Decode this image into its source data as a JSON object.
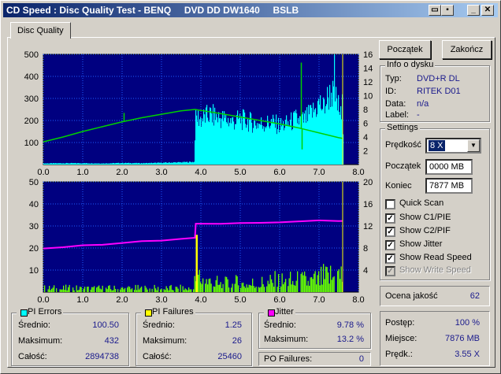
{
  "window": {
    "title": "CD Speed : Disc Quality Test - BENQ     DVD DD DW1640     BSLB",
    "controls": {
      "minimize": "_",
      "close": "✕"
    }
  },
  "tab": {
    "label": "Disc Quality"
  },
  "buttons": {
    "start": "Początek",
    "exit": "Zakończ"
  },
  "disc_info": {
    "title": "Info o dysku",
    "type_label": "Typ:",
    "type_value": "DVD+R DL",
    "id_label": "ID:",
    "id_value": "RITEK D01",
    "date_label": "Data:",
    "date_value": "n/a",
    "label_label": "Label:",
    "label_value": "-"
  },
  "settings": {
    "title": "Settings",
    "speed_label": "Prędkość",
    "speed_value": "8 X",
    "start_label": "Początek",
    "start_value": "0000 MB",
    "end_label": "Koniec",
    "end_value": "7877 MB",
    "checkboxes": [
      {
        "label": "Quick Scan",
        "checked": false,
        "disabled": false
      },
      {
        "label": "Show C1/PIE",
        "checked": true,
        "disabled": false
      },
      {
        "label": "Show C2/PIF",
        "checked": true,
        "disabled": false
      },
      {
        "label": "Show Jitter",
        "checked": true,
        "disabled": false
      },
      {
        "label": "Show Read Speed",
        "checked": true,
        "disabled": false
      },
      {
        "label": "Show Write Speed",
        "checked": true,
        "disabled": true
      }
    ]
  },
  "quality": {
    "label": "Ocena jakość",
    "value": "62"
  },
  "progress": {
    "progress_label": "Postęp:",
    "progress_value": "100 %",
    "position_label": "Miejsce:",
    "position_value": "7876 MB",
    "speed_label": "Prędk.:",
    "speed_value": "3.55 X"
  },
  "pi_errors": {
    "title": "PI Errors",
    "color": "#00ffff",
    "avg_label": "Średnio:",
    "avg": "100.50",
    "max_label": "Maksimum:",
    "max": "432",
    "total_label": "Całość:",
    "total": "2894738"
  },
  "pi_failures": {
    "title": "PI Failures",
    "color": "#ffff00",
    "avg_label": "Średnio:",
    "avg": "1.25",
    "max_label": "Maksimum:",
    "max": "26",
    "total_label": "Całość:",
    "total": "25460"
  },
  "jitter": {
    "title": "Jitter",
    "color": "#ff00ff",
    "avg_label": "Średnio:",
    "avg": "9.78 %",
    "max_label": "Maksimum:",
    "max": "13.2 %"
  },
  "po_failures": {
    "label": "PO Failures:",
    "value": "0"
  },
  "chart_data": [
    {
      "type": "area",
      "xlim": [
        0,
        8.0
      ],
      "x_ticks": [
        "0.0",
        "1.0",
        "2.0",
        "3.0",
        "4.0",
        "5.0",
        "6.0",
        "7.0",
        "8.0"
      ],
      "ylim": [
        0,
        500
      ],
      "y_ticks": [
        "500",
        "400",
        "300",
        "200",
        "100"
      ],
      "y2lim": [
        0,
        16
      ],
      "y2_ticks": [
        "16",
        "14",
        "12",
        "10",
        "8",
        "6",
        "4",
        "2"
      ],
      "colors": {
        "pie": "#00ffff",
        "speed": "#00d000",
        "marker": "#ffff00"
      },
      "pie": {
        "x": [
          0.0,
          0.5,
          1.0,
          1.5,
          2.0,
          2.5,
          3.0,
          3.5,
          3.82,
          3.85,
          3.9,
          4.0,
          4.2,
          4.4,
          4.6,
          4.8,
          5.0,
          5.2,
          5.4,
          5.6,
          5.8,
          6.0,
          6.2,
          6.4,
          6.55,
          6.7,
          6.9,
          7.0,
          7.1,
          7.2,
          7.3,
          7.4,
          7.5,
          7.6
        ],
        "y": [
          5,
          6,
          6,
          5,
          7,
          6,
          8,
          10,
          12,
          200,
          215,
          205,
          225,
          215,
          205,
          195,
          205,
          195,
          185,
          185,
          190,
          175,
          185,
          205,
          195,
          215,
          250,
          280,
          255,
          300,
          325,
          305,
          250,
          180
        ]
      },
      "speed": {
        "x": [
          0.0,
          0.5,
          1.0,
          1.5,
          2.0,
          2.5,
          3.0,
          3.5,
          3.85,
          4.5,
          5.0,
          5.5,
          6.0,
          6.5,
          7.0,
          7.5,
          7.6
        ],
        "y": [
          3.3,
          4.0,
          4.8,
          5.5,
          6.2,
          6.8,
          7.3,
          7.8,
          8.0,
          7.4,
          6.9,
          6.4,
          5.9,
          5.3,
          4.6,
          3.9,
          3.8
        ]
      },
      "spikes": [
        {
          "x": 2.05,
          "y": 7.5
        },
        {
          "x": 6.55,
          "y": 14.8
        },
        {
          "x": 6.57,
          "y": 2.2
        }
      ],
      "end_marker": 7.6
    },
    {
      "type": "bar",
      "xlim": [
        0,
        8.0
      ],
      "x_ticks": [
        "0.0",
        "1.0",
        "2.0",
        "3.0",
        "4.0",
        "5.0",
        "6.0",
        "7.0",
        "8.0"
      ],
      "ylim": [
        0,
        50
      ],
      "y_ticks": [
        "50",
        "40",
        "30",
        "20",
        "10"
      ],
      "y2lim": [
        0,
        20
      ],
      "y2_ticks": [
        "20",
        "16",
        "12",
        "8",
        "4"
      ],
      "colors": {
        "pif": "#66ff00",
        "pif_peak": "#ffff00",
        "jitter": "#ff00ff",
        "marker": "#ffff00"
      },
      "jitter": {
        "x": [
          0.0,
          0.5,
          1.0,
          1.5,
          2.0,
          2.5,
          3.0,
          3.5,
          3.85,
          3.87,
          4.5,
          5.0,
          5.5,
          6.0,
          6.5,
          7.0,
          7.5,
          7.6
        ],
        "y": [
          8.0,
          8.2,
          8.4,
          8.6,
          8.9,
          9.2,
          9.4,
          9.7,
          9.8,
          12.3,
          12.4,
          12.5,
          12.6,
          12.7,
          12.8,
          12.9,
          13.0,
          13.0
        ]
      },
      "pif_peak": {
        "x": 3.87,
        "y": 26
      },
      "pif_profile": {
        "x": [
          0.0,
          1.0,
          2.0,
          3.0,
          3.8,
          3.88,
          4.0,
          4.5,
          5.0,
          5.5,
          6.0,
          6.5,
          7.0,
          7.5,
          7.6
        ],
        "y": [
          2,
          2,
          2,
          2,
          2,
          12,
          8,
          4,
          5,
          5,
          6,
          6,
          7,
          11,
          9
        ]
      },
      "end_marker": 7.6
    }
  ]
}
